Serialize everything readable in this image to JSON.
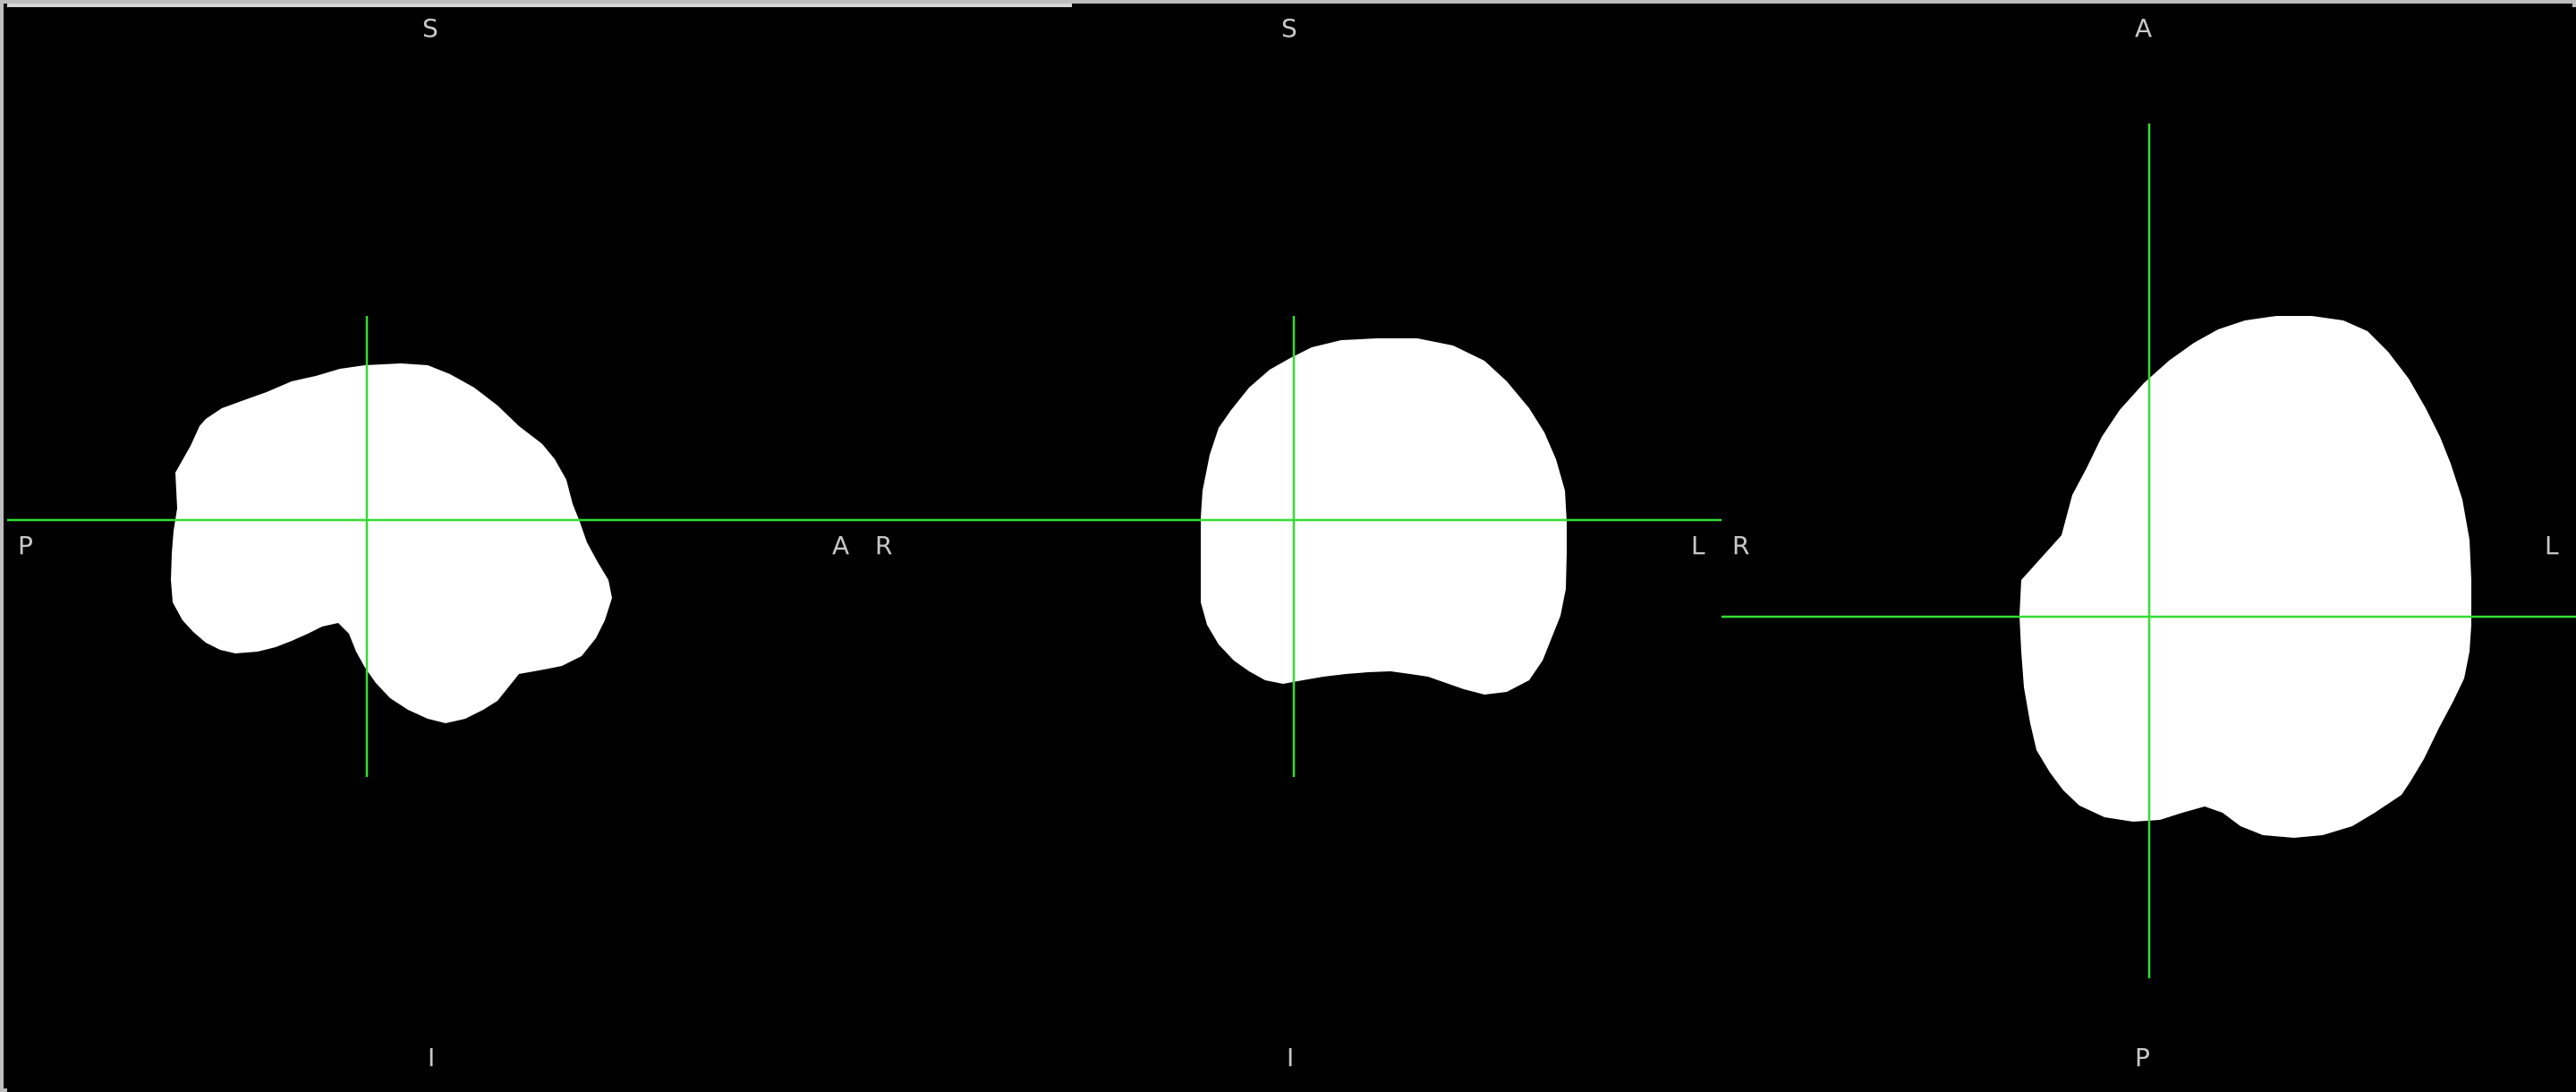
{
  "colors": {
    "background": "#000000",
    "mask": "#ffffff",
    "crosshair": "#33dd33",
    "orientation_label": "#c8c8c8",
    "frame_border": "#bdbdbd"
  },
  "views": {
    "sagittal": {
      "top": "S",
      "bottom": "I",
      "left": "P",
      "right": "A"
    },
    "coronal": {
      "top": "S",
      "bottom": "I",
      "left": "R",
      "right": "L"
    },
    "axial": {
      "top": "A",
      "bottom": "P",
      "left": "R",
      "right": "L"
    }
  }
}
